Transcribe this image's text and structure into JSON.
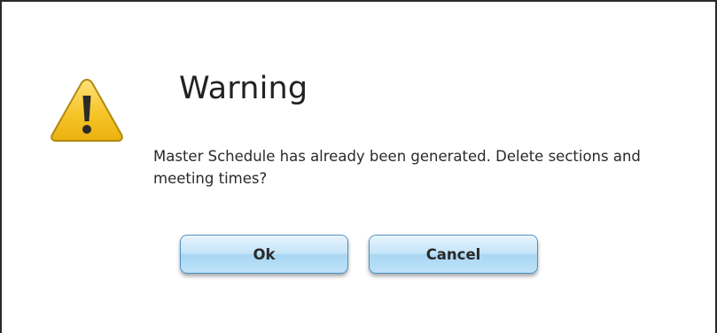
{
  "dialog": {
    "icon": "warning-icon",
    "title": "Warning",
    "message": "Master Schedule has already been generated. Delete sections and meeting times?",
    "buttons": {
      "ok_label": "Ok",
      "cancel_label": "Cancel"
    }
  },
  "colors": {
    "icon_fill": "#f5c72a",
    "icon_outline": "#b08a10",
    "button_border": "#4c8fc4",
    "button_fill": "#c4e4f8"
  }
}
